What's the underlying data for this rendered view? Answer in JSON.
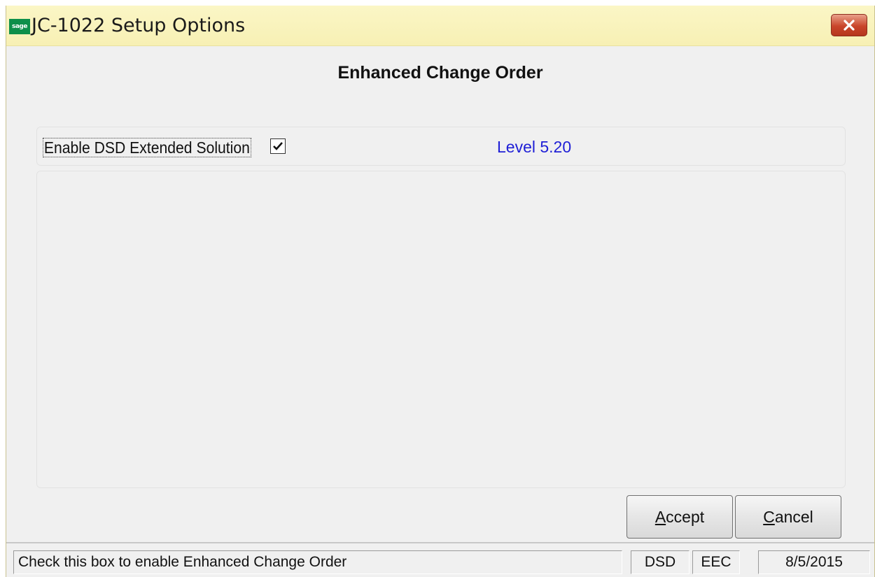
{
  "window": {
    "title": "JC-1022 Setup Options",
    "logo_text": "sage"
  },
  "heading": "Enhanced Change Order",
  "options": {
    "enable_label": "Enable DSD Extended Solution",
    "enable_checked": true,
    "level_text": "Level  5.20"
  },
  "buttons": {
    "accept": {
      "underline": "A",
      "rest": "ccept"
    },
    "cancel": {
      "underline": "C",
      "rest": "ancel"
    }
  },
  "statusbar": {
    "message": "Check this box to enable Enhanced Change Order",
    "module": "DSD",
    "product": "EEC",
    "date": "8/5/2015"
  },
  "colors": {
    "titlebar": "#f7f0b4",
    "level_text": "#1f1fd6",
    "close_button": "#c9452a",
    "logo": "#0e8f4a"
  }
}
